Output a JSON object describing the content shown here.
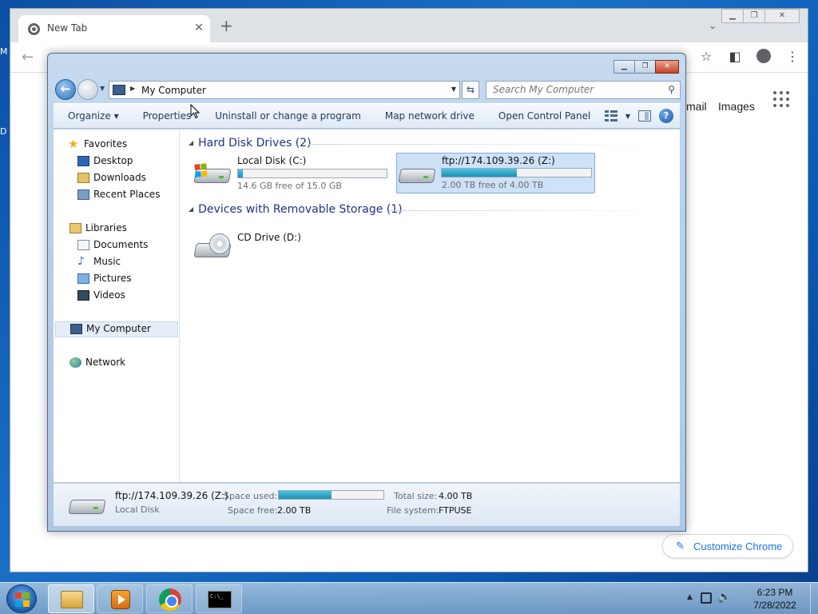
{
  "desktop_edge": {
    "top_char": "M",
    "mid_char": "D"
  },
  "chrome": {
    "tab": {
      "title": "New Tab",
      "close_glyph": "✕"
    },
    "new_tab_glyph": "+",
    "tab_search_glyph": "⌄",
    "window_controls": {
      "minimize": "▁",
      "maximize": "❐",
      "close": "✕"
    },
    "toolbar": {
      "back_glyph": "←",
      "star_glyph": "☆",
      "sidepanel_glyph": "◧",
      "menu_glyph": "⋮"
    },
    "page": {
      "gmail_label": "mail",
      "images_label": "Images",
      "customize_label": "Customize Chrome",
      "customize_icon": "✎"
    }
  },
  "explorer": {
    "window_controls": {
      "minimize": "▁",
      "maximize": "❐",
      "close": "✕"
    },
    "address": {
      "path": "My Computer",
      "sep_glyph": "▶",
      "dropdown_glyph": "▼"
    },
    "refresh_glyph": "⇆",
    "search": {
      "placeholder": "Search My Computer",
      "icon_glyph": "⚲"
    },
    "commands": [
      {
        "label": "Organize ▾"
      },
      {
        "label": "Properties"
      },
      {
        "label": "Uninstall or change a program"
      },
      {
        "label": "Map network drive"
      },
      {
        "label": "Open Control Panel"
      }
    ],
    "help_glyph": "?",
    "nav_pane": {
      "favorites": "Favorites",
      "desktop": "Desktop",
      "downloads": "Downloads",
      "recent": "Recent Places",
      "libraries": "Libraries",
      "documents": "Documents",
      "music": "Music",
      "pictures": "Pictures",
      "videos": "Videos",
      "computer": "My Computer",
      "network": "Network"
    },
    "groups": {
      "hdd": {
        "title": "Hard Disk Drives (2)"
      },
      "removable": {
        "title": "Devices with Removable Storage (1)"
      }
    },
    "drives": {
      "c": {
        "name": "Local Disk (C:)",
        "free": "14.6 GB free of 15.0 GB",
        "used_fraction": 0.03
      },
      "z": {
        "name": "ftp://174.109.39.26 (Z:)",
        "free": "2.00 TB free of 4.00 TB",
        "used_fraction": 0.5
      },
      "d": {
        "name": "CD Drive (D:)"
      }
    },
    "details": {
      "name": "ftp://174.109.39.26 (Z:)",
      "type": "Local Disk",
      "space_used_label": "Space used:",
      "space_used_fraction": 0.5,
      "space_free_label": "Space free:",
      "space_free_value": "2.00 TB",
      "total_label": "Total size:",
      "total_value": "4.00 TB",
      "fs_label": "File system:",
      "fs_value": "FTPUSE"
    }
  },
  "taskbar": {
    "clock_time": "6:23 PM",
    "clock_date": "7/28/2022",
    "tray_arrow": "▲",
    "volume_glyph": "🔈",
    "cmd_text": "C:\\_"
  },
  "colors": {
    "win_logo": [
      "#e8452c",
      "#7fba00",
      "#00a4ef",
      "#ffb900"
    ],
    "selection": "#cde2f7",
    "bar_fill": "#1b8fb3"
  }
}
